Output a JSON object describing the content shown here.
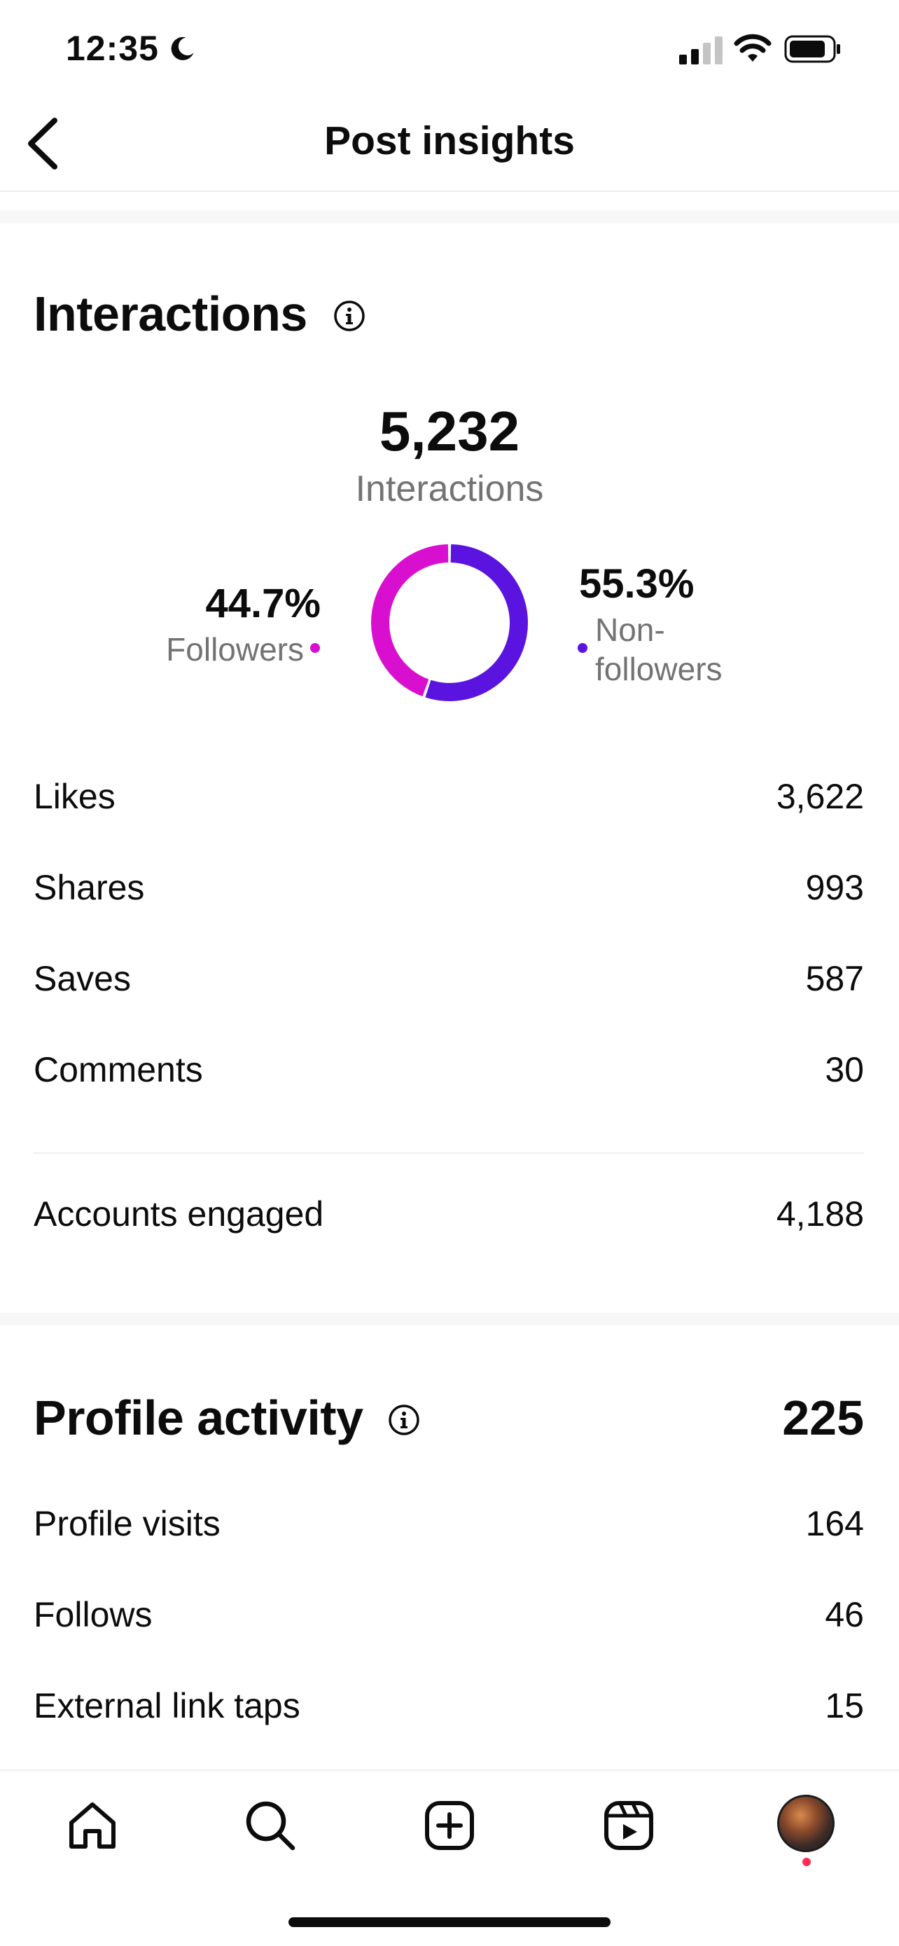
{
  "status_bar": {
    "time": "12:35"
  },
  "header": {
    "title": "Post insights"
  },
  "interactions": {
    "title": "Interactions",
    "total": "5,232",
    "total_label": "Interactions",
    "followers": {
      "pct": "44.7%",
      "label": "Followers",
      "color": "#d90fcf"
    },
    "non_followers": {
      "pct": "55.3%",
      "label_1": "Non-",
      "label_2": "followers",
      "color": "#5b14e0"
    },
    "rows": [
      {
        "label": "Likes",
        "value": "3,622"
      },
      {
        "label": "Shares",
        "value": "993"
      },
      {
        "label": "Saves",
        "value": "587"
      },
      {
        "label": "Comments",
        "value": "30"
      }
    ],
    "accounts_engaged": {
      "label": "Accounts engaged",
      "value": "4,188"
    }
  },
  "chart_data": {
    "type": "pie",
    "categories": [
      "Followers",
      "Non-followers"
    ],
    "values": [
      44.7,
      55.3
    ]
  },
  "profile_activity": {
    "title": "Profile activity",
    "total": "225",
    "rows": [
      {
        "label": "Profile visits",
        "value": "164"
      },
      {
        "label": "Follows",
        "value": "46"
      },
      {
        "label": "External link taps",
        "value": "15"
      }
    ]
  },
  "bottom_nav": {
    "items": [
      "home-icon",
      "search-icon",
      "create-icon",
      "reels-icon",
      "profile-avatar"
    ]
  },
  "colors": {
    "accent_followers": "#d90fcf",
    "accent_non_followers": "#5b14e0"
  }
}
